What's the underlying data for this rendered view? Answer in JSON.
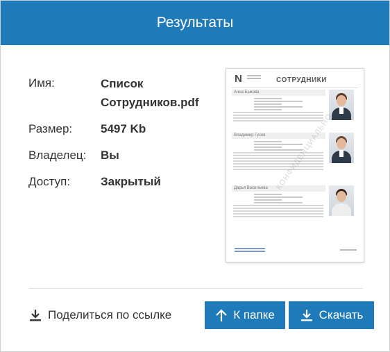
{
  "header": {
    "title": "Результаты"
  },
  "info": {
    "name_label": "Имя:",
    "name_value_line1": "Список",
    "name_value_line2": "Сотрудников.pdf",
    "size_label": "Размер:",
    "size_value": "5497 Kb",
    "owner_label": "Владелец:",
    "owner_value": "Вы",
    "access_label": "Доступ:",
    "access_value": "Закрытый"
  },
  "preview": {
    "logo_letter": "N",
    "doc_title": "СОТРУДНИКИ",
    "people": [
      "Анна Быкова",
      "Владимир Гусев",
      "Дарья Васильева"
    ],
    "watermark": "КОНФИДЕНЦИАЛЬНО"
  },
  "actions": {
    "share_label": "Поделиться по ссылке",
    "folder_label": "К папке",
    "download_label": "Скачать"
  },
  "icons": {
    "share": "download-tray-icon",
    "folder": "arrow-up-icon",
    "download": "download-tray-icon"
  },
  "colors": {
    "accent": "#1e7ab8",
    "header_text": "#ffffff",
    "text": "#333333"
  }
}
